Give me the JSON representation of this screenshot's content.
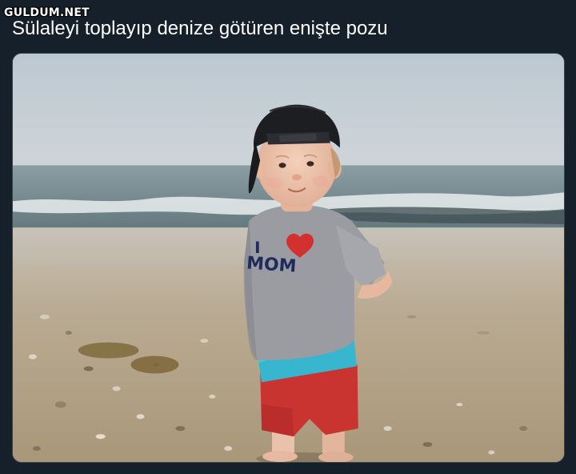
{
  "site": {
    "watermark": "GULDUM.NET"
  },
  "tweet": {
    "text": "Sülaleyi toplayıp denize götüren enişte pozu"
  },
  "photo": {
    "shirt_text_line1": "I",
    "shirt_text_line2": "MOM",
    "colors": {
      "sky": "#c6cfd6",
      "sea": "#6f858c",
      "sand": "#b3a389",
      "shirt": "#9a9ca2",
      "shorts": "#c93431",
      "band": "#38b6cf",
      "cap": "#1c1e22",
      "heart": "#d33030"
    }
  }
}
